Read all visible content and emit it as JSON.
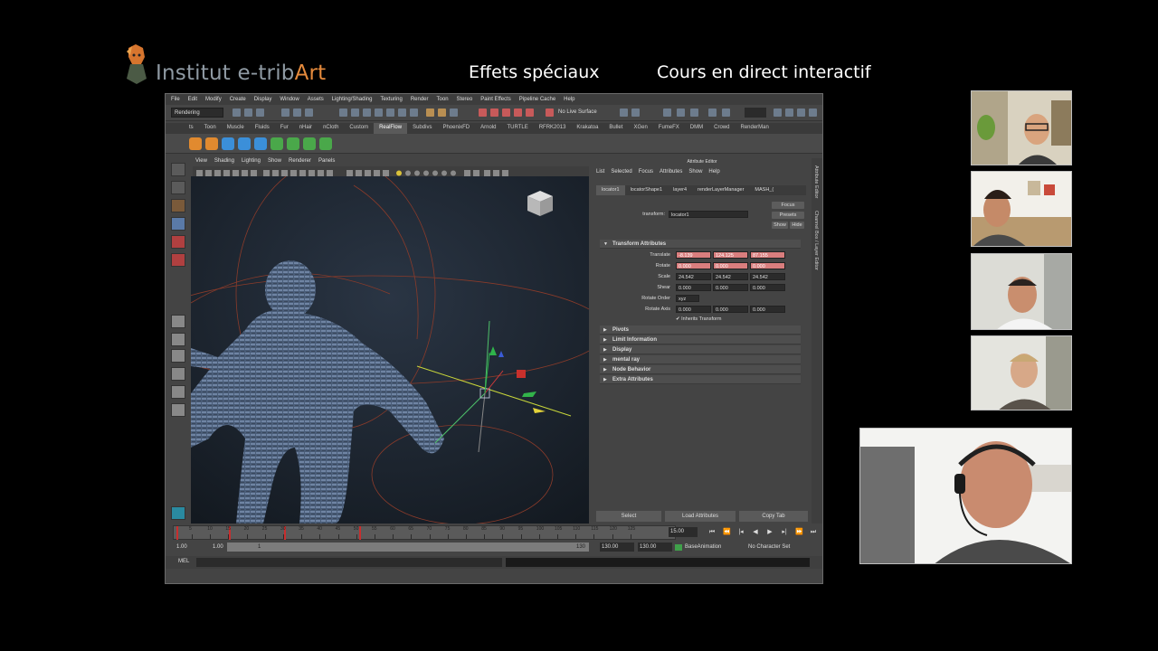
{
  "header": {
    "brand_prefix": "Institut e-trib",
    "brand_suffix": "Art",
    "course_title": "Effets spéciaux",
    "live_label": "Cours en direct interactif"
  },
  "maya": {
    "menu": [
      "File",
      "Edit",
      "Modify",
      "Create",
      "Display",
      "Window",
      "Assets",
      "Lighting/Shading",
      "Texturing",
      "Render",
      "Toon",
      "Stereo",
      "Paint Effects",
      "Pipeline Cache",
      "Help"
    ],
    "mode": "Rendering",
    "no_live_surface": "No Live Surface",
    "shelf_tabs": [
      "ts",
      "Toon",
      "Muscle",
      "Fluids",
      "Fur",
      "nHair",
      "nCloth",
      "Custom",
      "RealFlow",
      "Subdivs",
      "PhoenixFD",
      "Arnold",
      "TURTLE",
      "RFRK2013",
      "Krakatoa",
      "Bullet",
      "XGen",
      "FumeFX",
      "DMM",
      "Crowd",
      "RenderMan"
    ],
    "active_shelf": "RealFlow",
    "viewport_menu": [
      "View",
      "Shading",
      "Lighting",
      "Show",
      "Renderer",
      "Panels"
    ],
    "attribute_editor": {
      "title": "Attribute Editor",
      "menu": [
        "List",
        "Selected",
        "Focus",
        "Attributes",
        "Show",
        "Help"
      ],
      "tabs": [
        "locator1",
        "locatorShape1",
        "layer4",
        "renderLayerManager",
        "MASH_("
      ],
      "transform_label": "transform:",
      "transform_value": "locator1",
      "focus_btn": "Focus",
      "presets_btn": "Presets",
      "show_btn": "Show",
      "hide_btn": "Hide",
      "section_title": "Transform Attributes",
      "translate_label": "Translate",
      "translate": [
        "-8.139",
        "124.125",
        "87.155"
      ],
      "rotate_label": "Rotate",
      "rotate": [
        "0.000",
        "0.000",
        "0.000"
      ],
      "scale_label": "Scale",
      "scale": [
        "24.542",
        "24.542",
        "24.542"
      ],
      "shear_label": "Shear",
      "shear": [
        "0.000",
        "0.000",
        "0.000"
      ],
      "rotate_order_label": "Rotate Order",
      "rotate_order": "xyz",
      "rotate_axis_label": "Rotate Axis",
      "rotate_axis": [
        "0.000",
        "0.000",
        "0.000"
      ],
      "inherits_transform": "Inherits Transform",
      "sections": [
        "Pivots",
        "Limit Information",
        "Display",
        "mental ray",
        "Node Behavior",
        "Extra Attributes"
      ],
      "select_btn": "Select",
      "load_btn": "Load Attributes",
      "copy_btn": "Copy Tab",
      "side_tabs": [
        "Attribute Editor",
        "Channel Box / Layer Editor"
      ]
    },
    "timeline": {
      "ticks": [
        "5",
        "10",
        "15",
        "20",
        "25",
        "30",
        "35",
        "40",
        "45",
        "50",
        "55",
        "60",
        "65",
        "70",
        "75",
        "80",
        "85",
        "90",
        "95",
        "100",
        "105",
        "110",
        "115",
        "120",
        "125"
      ],
      "current_frame": "15.00",
      "range_start": "1.00",
      "range_start2": "1.00",
      "range_mid": "1",
      "range_end_marker": "130",
      "range_end": "130.00",
      "range_end2": "130.00",
      "anim_layer": "BaseAnimation",
      "character_set": "No Character Set"
    },
    "mel_label": "MEL"
  }
}
